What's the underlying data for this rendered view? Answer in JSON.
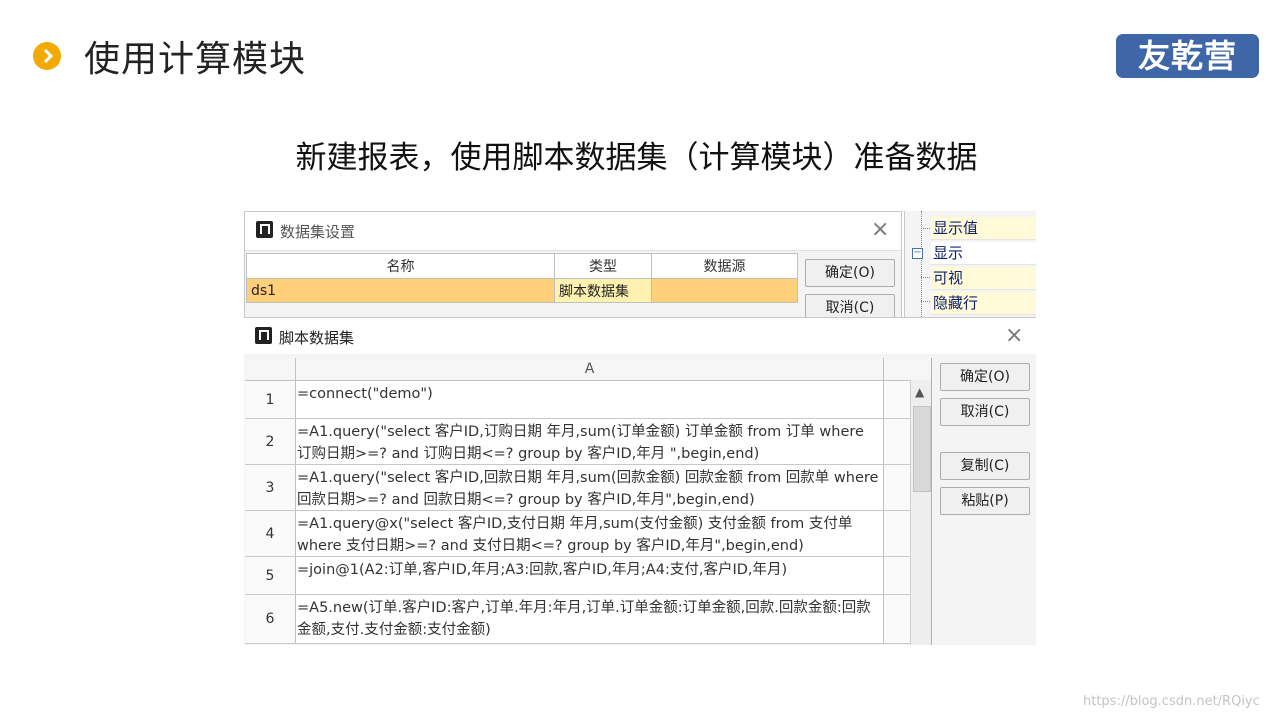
{
  "slide": {
    "title": "使用计算模块",
    "logo": "友乾营",
    "subtitle": "新建报表，使用脚本数据集（计算模块）准备数据"
  },
  "dataset_dialog": {
    "title": "数据集设置",
    "columns": [
      "名称",
      "类型",
      "数据源"
    ],
    "row": {
      "name": "ds1",
      "type": "脚本数据集",
      "source": ""
    },
    "ok_label": "确定(O)",
    "cancel_label": "取消(C)"
  },
  "property_tree": {
    "items": [
      {
        "label": "显示值"
      },
      {
        "label": "显示",
        "expand": "−"
      },
      {
        "label": "可视"
      },
      {
        "label": "隐藏行"
      }
    ]
  },
  "script_dialog": {
    "title": "脚本数据集",
    "column_header": "A",
    "rows": [
      {
        "num": "1",
        "code": "=connect(\"demo\")"
      },
      {
        "num": "2",
        "code": "=A1.query(\"select 客户ID,订购日期 年月,sum(订单金额) 订单金额 from 订单 where 订购日期>=? and 订购日期<=? group by 客户ID,年月 \",begin,end)"
      },
      {
        "num": "3",
        "code": "=A1.query(\"select 客户ID,回款日期 年月,sum(回款金额) 回款金额 from 回款单  where 回款日期>=? and 回款日期<=? group by 客户ID,年月\",begin,end)"
      },
      {
        "num": "4",
        "code": "=A1.query@x(\"select 客户ID,支付日期 年月,sum(支付金额) 支付金额 from 支付单 where 支付日期>=? and 支付日期<=? group by 客户ID,年月\",begin,end)"
      },
      {
        "num": "5",
        "code": "=join@1(A2:订单,客户ID,年月;A3:回款,客户ID,年月;A4:支付,客户ID,年月)"
      },
      {
        "num": "6",
        "code": "=A5.new(订单.客户ID:客户,订单.年月:年月,订单.订单金额:订单金额,回款.回款金额:回款金额,支付.支付金额:支付金额)"
      }
    ],
    "buttons": {
      "ok": "确定(O)",
      "cancel": "取消(C)",
      "copy": "复制(C)",
      "paste": "粘贴(P)"
    }
  },
  "watermark": "https://blog.csdn.net/RQiyc"
}
